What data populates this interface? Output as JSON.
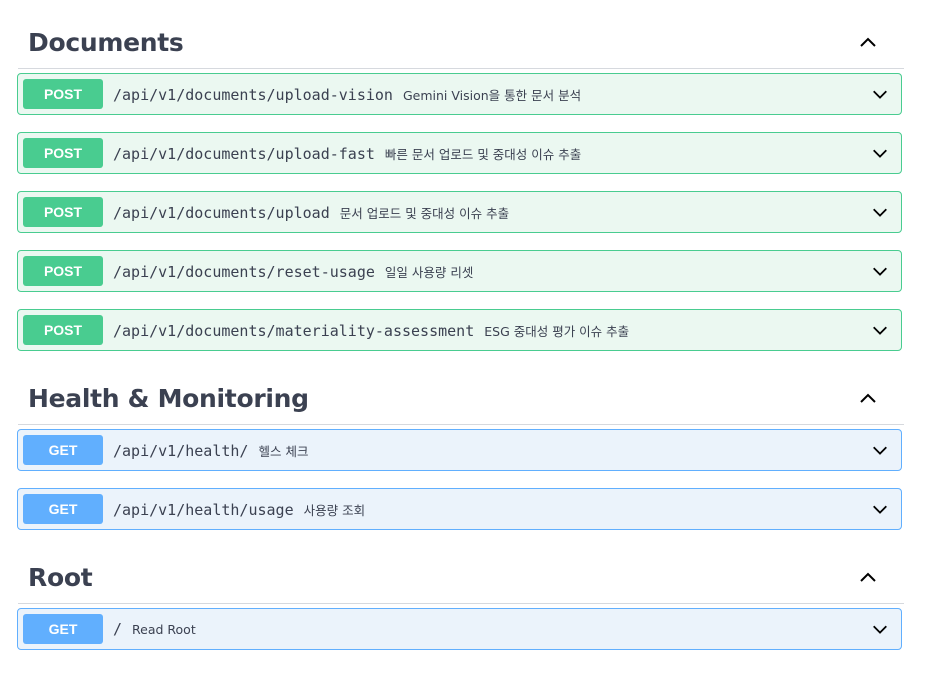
{
  "sections": [
    {
      "title": "Documents",
      "operations": [
        {
          "method": "POST",
          "path": "/api/v1/documents/upload-vision",
          "summary": "Gemini Vision을 통한 문서 분석"
        },
        {
          "method": "POST",
          "path": "/api/v1/documents/upload-fast",
          "summary": "빠른 문서 업로드 및 중대성 이슈 추출"
        },
        {
          "method": "POST",
          "path": "/api/v1/documents/upload",
          "summary": "문서 업로드 및 중대성 이슈 추출"
        },
        {
          "method": "POST",
          "path": "/api/v1/documents/reset-usage",
          "summary": "일일 사용량 리셋"
        },
        {
          "method": "POST",
          "path": "/api/v1/documents/materiality-assessment",
          "summary": "ESG 중대성 평가 이슈 추출"
        }
      ]
    },
    {
      "title": "Health & Monitoring",
      "operations": [
        {
          "method": "GET",
          "path": "/api/v1/health/",
          "summary": "헬스 체크"
        },
        {
          "method": "GET",
          "path": "/api/v1/health/usage",
          "summary": "사용량 조회"
        }
      ]
    },
    {
      "title": "Root",
      "operations": [
        {
          "method": "GET",
          "path": "/",
          "summary": "Read Root"
        }
      ]
    }
  ],
  "colors": {
    "post": "#49cc90",
    "get": "#61affe",
    "text": "#3b4151"
  },
  "icons": {
    "collapse": "chevron-up-icon",
    "expand": "chevron-down-icon"
  }
}
